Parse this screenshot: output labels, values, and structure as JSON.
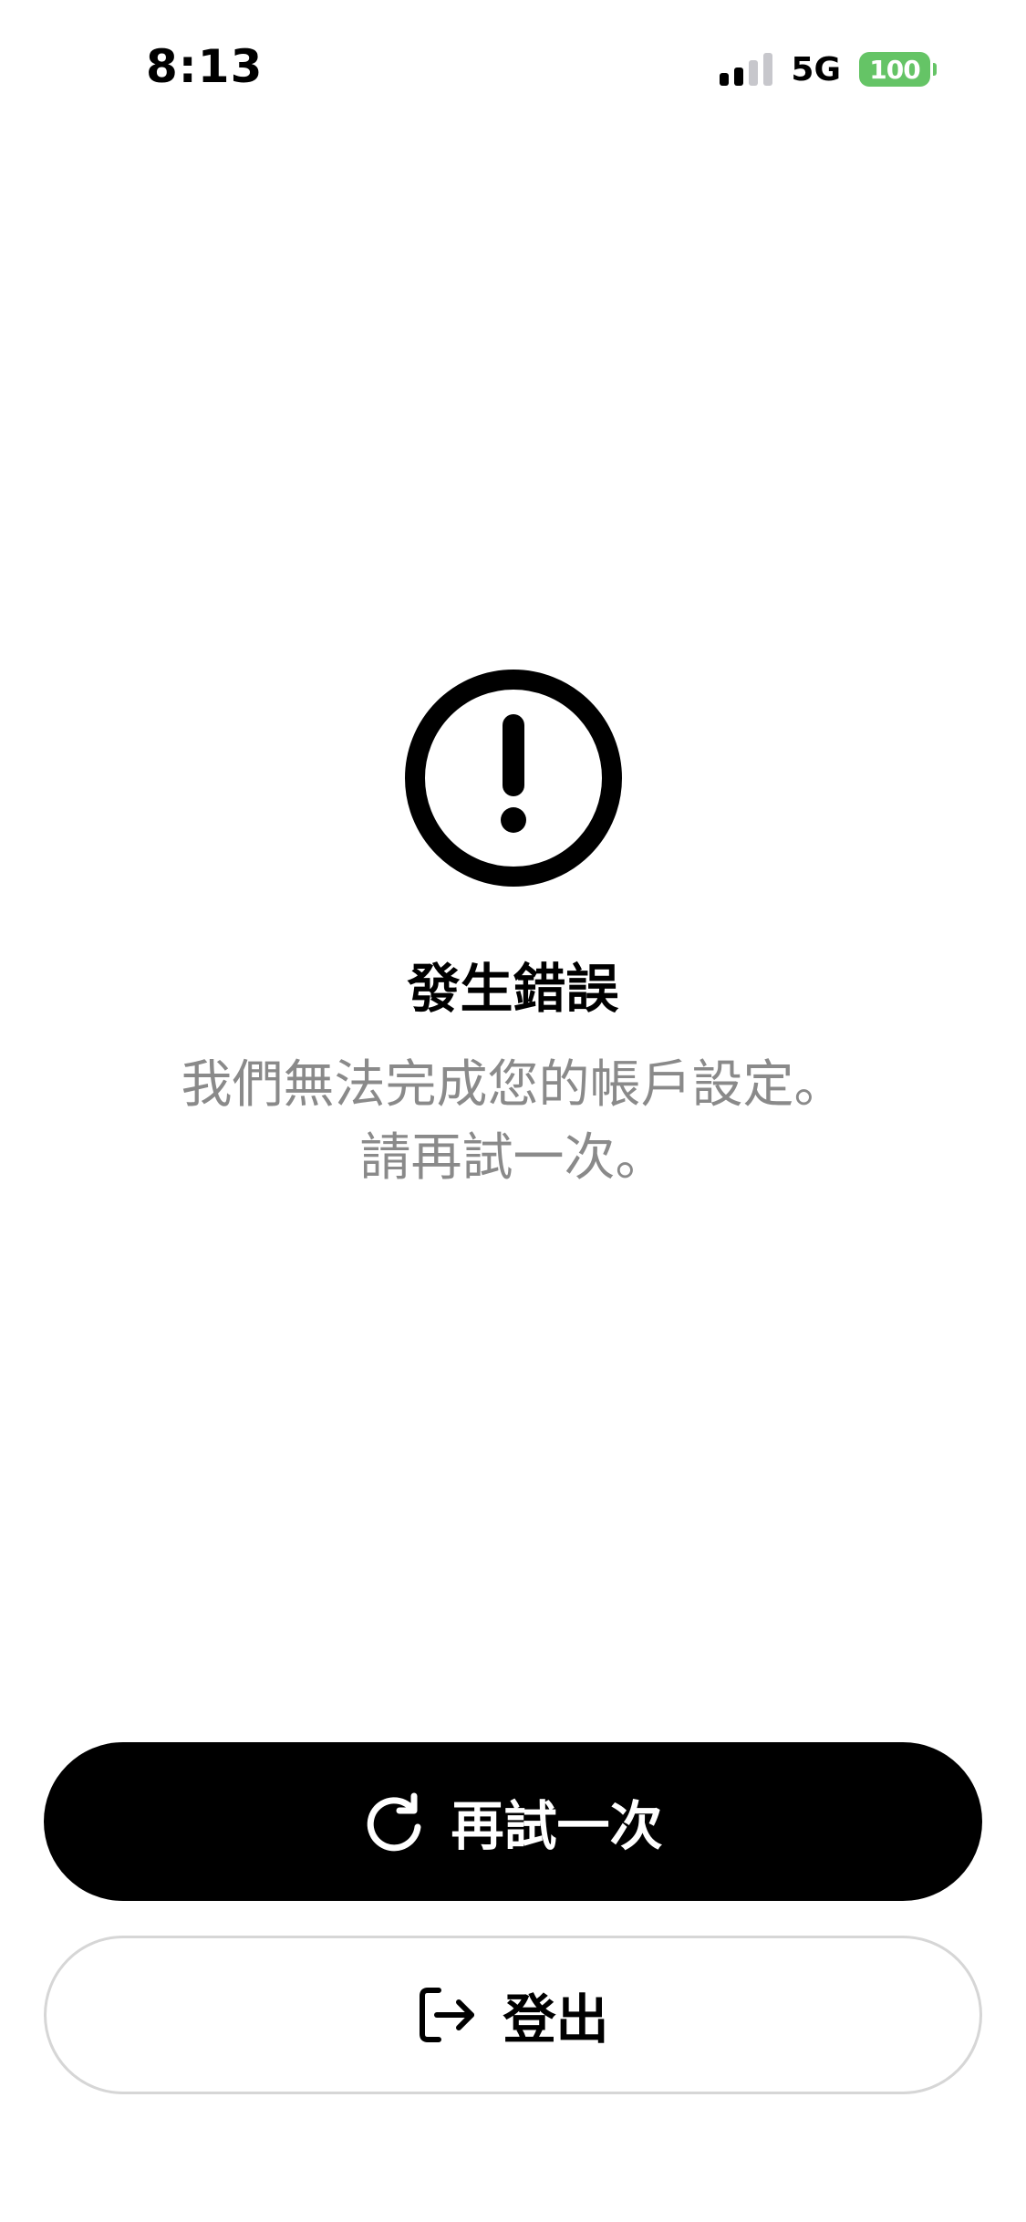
{
  "status_bar": {
    "time": "8:13",
    "network": "5G",
    "battery": "100",
    "colors": {
      "battery": "#65c466",
      "signal_dim": "#c7c7cc"
    }
  },
  "error": {
    "icon": "exclamation-circle-icon",
    "title": "發生錯誤",
    "message_line1": "我們無法完成您的帳戶設定。",
    "message_line2": "請再試一次。"
  },
  "actions": {
    "retry": {
      "label": "再試一次",
      "icon": "refresh-icon"
    },
    "logout": {
      "label": "登出",
      "icon": "logout-icon"
    }
  }
}
